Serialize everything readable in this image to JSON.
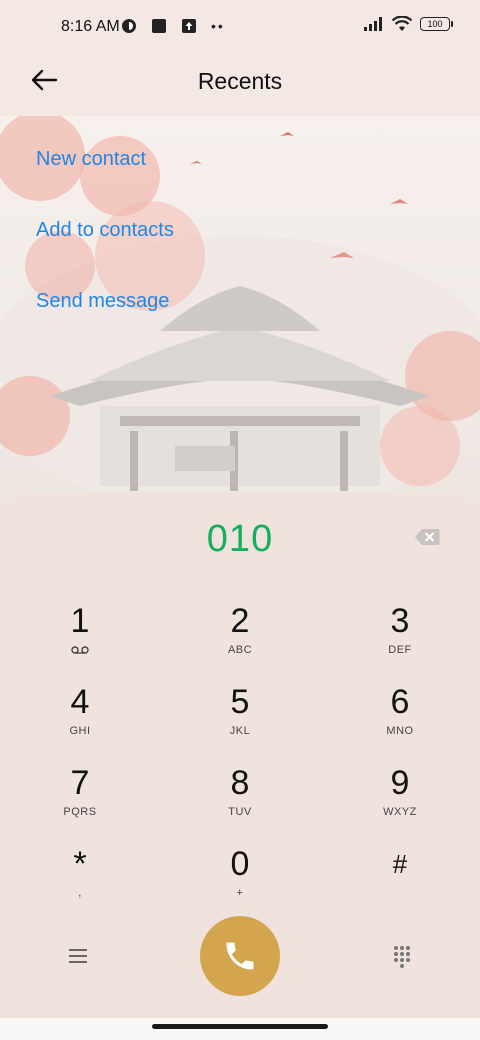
{
  "status_bar": {
    "time": "8:16 AM",
    "battery": "100",
    "icons": [
      "mi-icon",
      "square-app-icon",
      "upload-icon",
      "more-dots-icon",
      "signal-icon",
      "wifi-icon",
      "battery-icon"
    ]
  },
  "header": {
    "title": "Recents",
    "back_icon": "arrow-left-icon"
  },
  "actions": {
    "new_contact": "New contact",
    "add_to_contacts": "Add to contacts",
    "send_message": "Send message"
  },
  "dialer": {
    "number": "010",
    "number_color": "#12b05a",
    "keys": [
      {
        "digit": "1",
        "letters": ""
      },
      {
        "digit": "2",
        "letters": "ABC"
      },
      {
        "digit": "3",
        "letters": "DEF"
      },
      {
        "digit": "4",
        "letters": "GHI"
      },
      {
        "digit": "5",
        "letters": "JKL"
      },
      {
        "digit": "6",
        "letters": "MNO"
      },
      {
        "digit": "7",
        "letters": "PQRS"
      },
      {
        "digit": "8",
        "letters": "TUV"
      },
      {
        "digit": "9",
        "letters": "WXYZ"
      },
      {
        "digit": "*",
        "letters": ","
      },
      {
        "digit": "0",
        "letters": "+"
      },
      {
        "digit": "#",
        "letters": ""
      }
    ],
    "call_button_color": "#d4a54f"
  },
  "colors": {
    "link": "#1f86e6",
    "background": "#f3e8e4"
  }
}
